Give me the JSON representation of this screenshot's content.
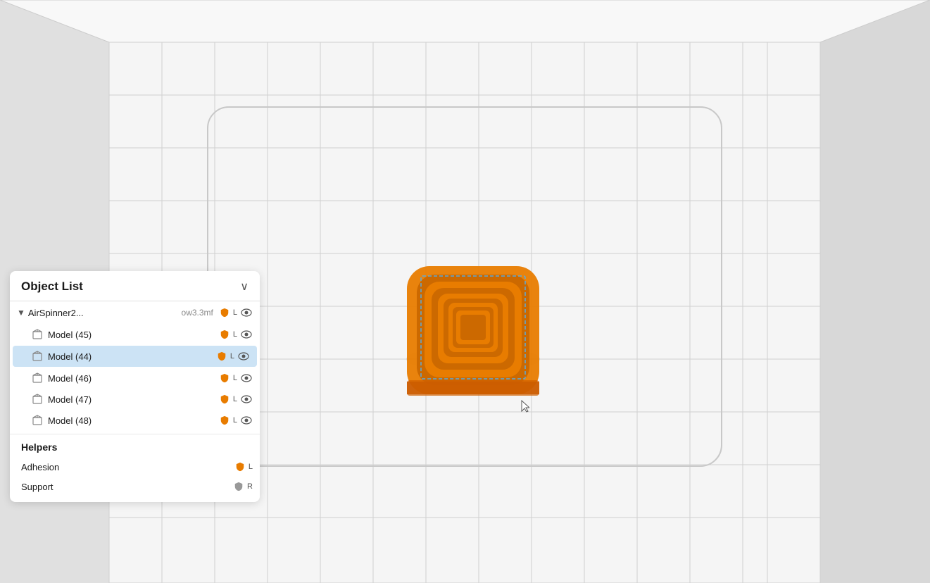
{
  "viewport": {
    "background": "#f0f0f0",
    "grid_color": "#d8d8d8"
  },
  "panel": {
    "title": "Object List",
    "collapse_symbol": "∨",
    "parent": {
      "name": "AirSpinner2...",
      "sub": "ow3.3mf",
      "badge": "L",
      "expanded": true
    },
    "items": [
      {
        "label": "Model (45)",
        "badge": "L",
        "selected": false
      },
      {
        "label": "Model (44)",
        "badge": "L",
        "selected": true
      },
      {
        "label": "Model (46)",
        "badge": "L",
        "selected": false
      },
      {
        "label": "Model (47)",
        "badge": "L",
        "selected": false
      },
      {
        "label": "Model (48)",
        "badge": "L",
        "selected": false
      }
    ],
    "helpers": {
      "title": "Helpers",
      "items": [
        {
          "label": "Adhesion",
          "badge": "L",
          "shield_color": "orange"
        },
        {
          "label": "Support",
          "badge": "R",
          "shield_color": "gray"
        }
      ]
    }
  },
  "colors": {
    "orange": "#E87C00",
    "selected_bg": "#cce3f5",
    "panel_bg": "#ffffff",
    "grid": "#d5d5d5"
  }
}
